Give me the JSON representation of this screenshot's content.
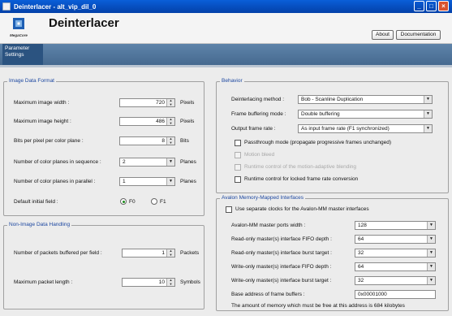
{
  "window": {
    "title": "Deinterlacer - alt_vip_dil_0"
  },
  "header": {
    "logo_text": "MegaCore",
    "title": "Deinterlacer",
    "about_label": "About",
    "documentation_label": "Documentation"
  },
  "tabs": {
    "parameter_settings_line1": "Parameter",
    "parameter_settings_line2": "Settings"
  },
  "image_data_format": {
    "title": "Image Data Format",
    "max_width_label": "Maximum image width :",
    "max_width_value": "720",
    "max_width_unit": "Pixels",
    "max_height_label": "Maximum image height :",
    "max_height_value": "486",
    "max_height_unit": "Pixels",
    "bits_label": "Bits per pixel per color plane :",
    "bits_value": "8",
    "bits_unit": "Bits",
    "seq_label": "Number of color planes in sequence :",
    "seq_value": "2",
    "seq_unit": "Planes",
    "par_label": "Number of color planes in parallel :",
    "par_value": "1",
    "par_unit": "Planes",
    "default_field_label": "Default initial field :",
    "f0_label": "F0",
    "f1_label": "F1",
    "default_field_selected": "F0"
  },
  "non_image": {
    "title": "Non-Image Data Handling",
    "packets_label": "Number of packets buffered per field :",
    "packets_value": "1",
    "packets_unit": "Packets",
    "max_len_label": "Maximum packet length :",
    "max_len_value": "10",
    "max_len_unit": "Symbols"
  },
  "behavior": {
    "title": "Behavior",
    "method_label": "Deinterlacing method :",
    "method_value": "Bob - Scanline Duplication",
    "buffering_label": "Frame buffering mode :",
    "buffering_value": "Double buffering",
    "rate_label": "Output frame rate :",
    "rate_value": "As input frame rate (F1 synchronized)",
    "passthrough_label": "Passthrough mode (propagate progressive frames unchanged)",
    "passthrough_checked": false,
    "motion_bleed_label": "Motion bleed",
    "runtime_motion_label": "Runtime control of the motion-adaptive blending",
    "runtime_locked_label": "Runtime control for locked frame rate conversion",
    "runtime_locked_checked": false
  },
  "avalon": {
    "title": "Avalon Memory-Mapped Interfaces",
    "separate_clocks_label": "Use separate clocks for the Avalon-MM master interfaces",
    "separate_clocks_checked": false,
    "port_width_label": "Avalon-MM master ports width :",
    "port_width_value": "128",
    "ro_fifo_label": "Read-only master(s) interface FIFO depth :",
    "ro_fifo_value": "64",
    "ro_burst_label": "Read-only master(s) interface burst target :",
    "ro_burst_value": "32",
    "wo_fifo_label": "Write-only master(s) interface FIFO depth :",
    "wo_fifo_value": "64",
    "wo_burst_label": "Write-only master(s) interface burst target :",
    "wo_burst_value": "32",
    "base_addr_label": "Base address of frame buffers :",
    "base_addr_value": "0x00001000",
    "memory_note": "The amount of memory which must be free at this address is 684 kilobytes"
  },
  "colors": {
    "title_bar": "#0a5fd8",
    "tab_active": "#2b5380",
    "group_title": "#1c47a0"
  },
  "icons": {
    "spin_up": "up-arrow",
    "spin_down": "down-arrow",
    "dropdown": "chevron-down"
  }
}
